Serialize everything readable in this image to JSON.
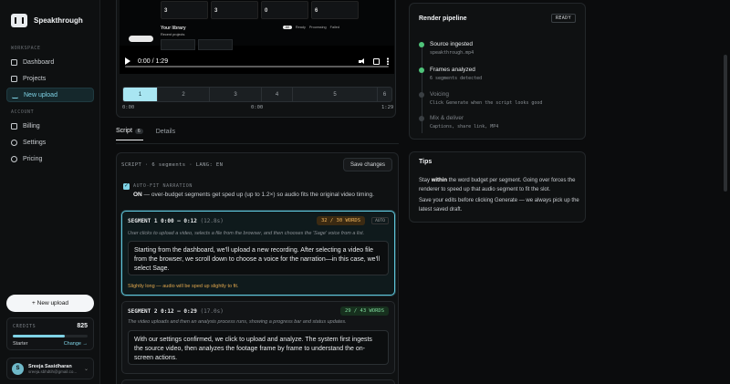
{
  "brand": {
    "name": "Speakthrough",
    "logo_icon": "waveform-icon"
  },
  "sidebar": {
    "workspace_label": "WORKSPACE",
    "account_label": "ACCOUNT",
    "workspace_items": [
      {
        "label": "Dashboard",
        "icon": "dashboard-icon"
      },
      {
        "label": "Projects",
        "icon": "folder-icon"
      },
      {
        "label": "New upload",
        "icon": "upload-icon",
        "active": true
      }
    ],
    "account_items": [
      {
        "label": "Billing",
        "icon": "card-icon"
      },
      {
        "label": "Settings",
        "icon": "gear-icon"
      },
      {
        "label": "Pricing",
        "icon": "tag-icon"
      }
    ],
    "new_upload_button": "+ New upload",
    "credits": {
      "label": "CREDITS",
      "value": "825",
      "plan": "Starter",
      "change": "Change →",
      "fill_fraction": 0.7
    },
    "user": {
      "initial": "S",
      "name": "Sreeja Sasidharan",
      "email": "sreeja.sbhdtih@gmail.co..."
    }
  },
  "video": {
    "time": "0:00 / 1:29",
    "preview": {
      "stat_values": [
        "3",
        "3",
        "0",
        "6"
      ],
      "library_title": "Your library",
      "library_sub": "Recent projects",
      "tabs": [
        "All",
        "Ready",
        "Processing",
        "Failed"
      ]
    }
  },
  "segment_strip": {
    "segments": [
      "1",
      "2",
      "3",
      "4",
      "5",
      "6"
    ],
    "selected": 0,
    "times": {
      "start": "0:00",
      "mid": "0:00",
      "end": "1:29"
    }
  },
  "tabs": [
    {
      "label": "Script",
      "count": "6",
      "active": true
    },
    {
      "label": "Details",
      "active": false
    }
  ],
  "script": {
    "header": "SCRIPT · 6 segments · LANG: EN",
    "save_label": "Save changes",
    "autofit": {
      "title": "AUTO-FIT NARRATION",
      "on": "ON",
      "desc": " — over-budget segments get sped up (up to 1.2×) so audio fits the original video timing."
    },
    "segments": [
      {
        "label": "SEGMENT 1",
        "range": "0:00 – 0:12",
        "duration": "(12.8s)",
        "words": "32 / 30 WORDS",
        "status": "warn",
        "auto": "AUTO",
        "desc": "User clicks to upload a video, selects a file from the browser, and then chooses the 'Sage' voice from a list.",
        "text": "Starting from the dashboard, we'll upload a new recording. After selecting a video file from the browser, we scroll down to choose a voice for the narration—in this case, we'll select Sage.",
        "note": "Slightly long — audio will be sped up slightly to fit."
      },
      {
        "label": "SEGMENT 2",
        "range": "0:12 – 0:29",
        "duration": "(17.0s)",
        "words": "29 / 43 WORDS",
        "status": "ok",
        "desc": "The video uploads and then an analysis process runs, showing a progress bar and status updates.",
        "text": "With our settings confirmed, we click to upload and analyze. The system first ingests the source video, then analyzes the footage frame by frame to understand the on-screen actions."
      }
    ]
  },
  "pipeline": {
    "title": "Render pipeline",
    "badge": "READY",
    "steps": [
      {
        "label": "Source ingested",
        "sub": "speakthrough.mp4",
        "done": true
      },
      {
        "label": "Frames analyzed",
        "sub": "6 segments detected",
        "done": true
      },
      {
        "label": "Voicing",
        "sub": "Click Generate when the script looks good",
        "done": false
      },
      {
        "label": "Mix & deliver",
        "sub": "Captions, share link, MP4",
        "done": false
      }
    ]
  },
  "tips": {
    "title": "Tips",
    "line1_a": "Stay ",
    "line1_b": "within",
    "line1_c": " the word budget per segment. Going over forces the renderer to speed up that audio segment to fit the slot.",
    "line2": "Save your edits before clicking Generate — we always pick up the latest saved draft."
  }
}
